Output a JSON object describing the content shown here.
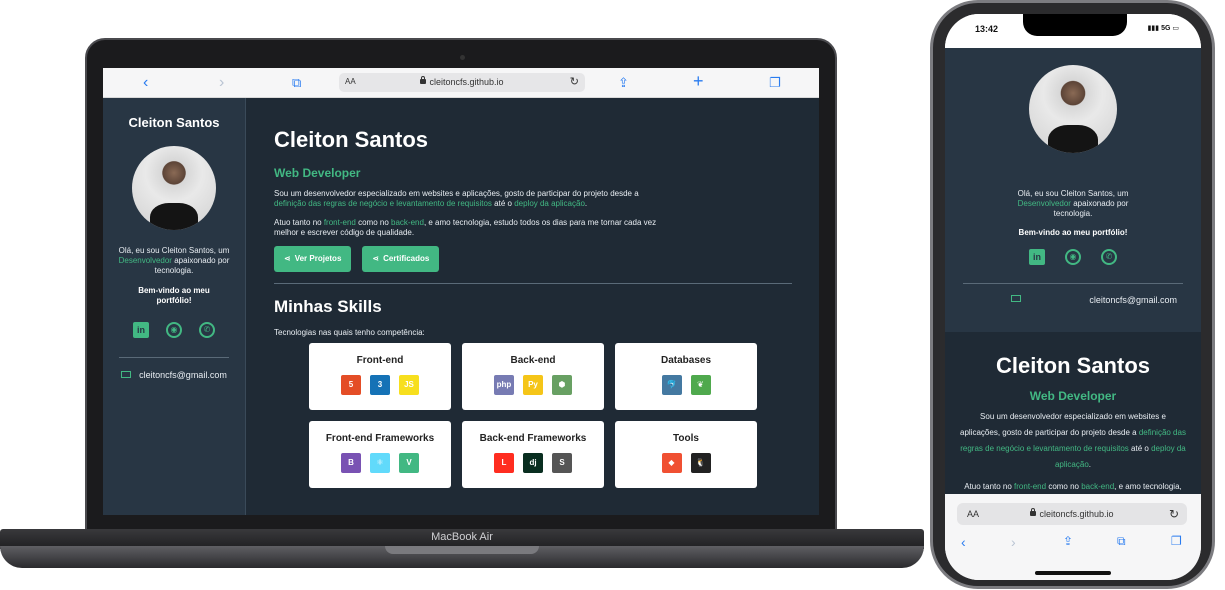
{
  "laptop": {
    "label": "MacBook Air",
    "browser": {
      "aa": "AA",
      "url": "cleitoncfs.github.io",
      "icons": {
        "back": "chevron-left-icon",
        "forward": "chevron-right-icon",
        "bookmarks": "book-icon",
        "share": "share-icon",
        "new_tab": "plus-icon",
        "tabs": "tabs-icon",
        "reload": "reload-icon"
      }
    },
    "sidebar": {
      "name": "Cleiton Santos",
      "bio_prefix": "Olá, eu sou Cleiton Santos, um",
      "bio_highlight": "Desenvolvedor",
      "bio_suffix": "apaixonado por tecnologia.",
      "welcome": "Bem-vindo ao meu portfólio!",
      "email": "cleitoncfs@gmail.com"
    },
    "main": {
      "title": "Cleiton Santos",
      "role": "Web Developer",
      "p1_a": "Sou um desenvolvedor especializado em websites e aplicações, gosto de participar do projeto desde a",
      "p1_link1": "definição das regras de negócio e levantamento de requisitos",
      "p1_mid": "até o",
      "p1_link2": "deploy da aplicação",
      "p1_end": ".",
      "p2_a": "Atuo tanto no",
      "p2_link1": "front-end",
      "p2_mid": "como no",
      "p2_link2": "back-end",
      "p2_end": ", e amo tecnologia, estudo todos os dias para me tornar cada vez melhor e escrever código de qualidade.",
      "btn_projects": "Ver Projetos",
      "btn_certs": "Certificados",
      "skills_title": "Minhas Skills",
      "skills_sub": "Tecnologias nas quais tenho competência:",
      "cards": [
        {
          "title": "Front-end",
          "icons": [
            {
              "name": "html5-icon",
              "glyph": "5",
              "color": "#e44d26"
            },
            {
              "name": "css3-icon",
              "glyph": "3",
              "color": "#1572b6"
            },
            {
              "name": "javascript-icon",
              "glyph": "JS",
              "color": "#f7df1e"
            }
          ]
        },
        {
          "title": "Back-end",
          "icons": [
            {
              "name": "php-icon",
              "glyph": "php",
              "color": "#777bb3"
            },
            {
              "name": "python-icon",
              "glyph": "Py",
              "color": "#f5c518"
            },
            {
              "name": "nodejs-icon",
              "glyph": "⬢",
              "color": "#68a063"
            }
          ]
        },
        {
          "title": "Databases",
          "icons": [
            {
              "name": "mysql-icon",
              "glyph": "🐬",
              "color": "#4479a1"
            },
            {
              "name": "mongodb-icon",
              "glyph": "❦",
              "color": "#4fa94d"
            }
          ]
        },
        {
          "title": "Front-end Frameworks",
          "icons": [
            {
              "name": "bootstrap-icon",
              "glyph": "B",
              "color": "#7952b3"
            },
            {
              "name": "react-icon",
              "glyph": "⚛",
              "color": "#61dafb"
            },
            {
              "name": "vue-icon",
              "glyph": "V",
              "color": "#42b883"
            }
          ]
        },
        {
          "title": "Back-end Frameworks",
          "icons": [
            {
              "name": "laravel-icon",
              "glyph": "L",
              "color": "#ff2d20"
            },
            {
              "name": "django-icon",
              "glyph": "dj",
              "color": "#092e20"
            },
            {
              "name": "slim-icon",
              "glyph": "S",
              "color": "#555555"
            }
          ]
        },
        {
          "title": "Tools",
          "icons": [
            {
              "name": "git-icon",
              "glyph": "◆",
              "color": "#f05032"
            },
            {
              "name": "linux-icon",
              "glyph": "🐧",
              "color": "#222222"
            }
          ]
        }
      ]
    }
  },
  "phone": {
    "status": {
      "time": "13:42",
      "signal": "5G"
    },
    "bio_prefix": "Olá, eu sou Cleiton Santos, um",
    "bio_highlight": "Desenvolvedor",
    "bio_suffix": "apaixonado por tecnologia.",
    "welcome": "Bem-vindo ao meu portfólio!",
    "email": "cleitoncfs@gmail.com",
    "title": "Cleiton Santos",
    "role": "Web Developer",
    "p1_a": "Sou um desenvolvedor especializado em websites e aplicações, gosto de participar do projeto desde a",
    "p1_link1": "definição das regras de negócio e levantamento de requisitos",
    "p1_mid": "até o",
    "p1_link2": "deploy da aplicação",
    "p1_end": ".",
    "p2_a": "Atuo tanto no",
    "p2_link1": "front-end",
    "p2_mid": "como no",
    "p2_link2": "back-end",
    "p2_end": ", e amo tecnologia, estudo todos os dias para me tornar",
    "browser": {
      "aa": "AA",
      "url": "cleitoncfs.github.io"
    }
  },
  "colors": {
    "accent": "#42b883",
    "sidebar_bg": "#283644",
    "main_bg": "#1f2a35"
  }
}
